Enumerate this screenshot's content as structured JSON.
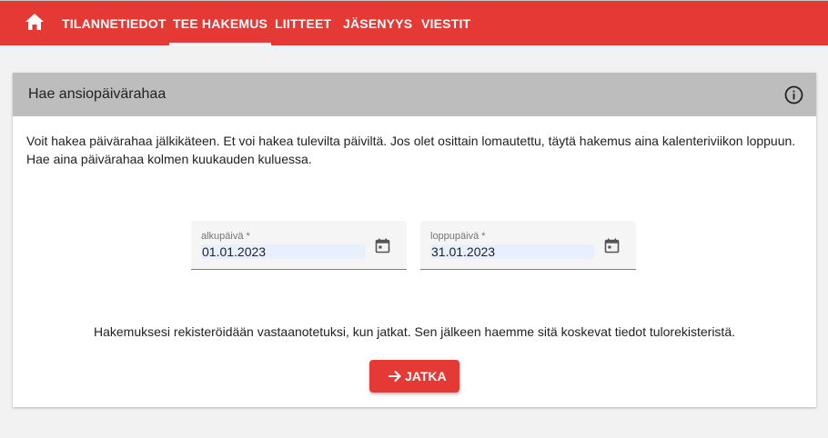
{
  "nav": {
    "home_icon": "home-icon",
    "items": [
      {
        "label": "TILANNETIEDOT",
        "active": false
      },
      {
        "label": "TEE HAKEMUS",
        "active": true
      },
      {
        "label": "LIITTEET",
        "active": false
      },
      {
        "label": "JÄSENYYS",
        "active": false
      },
      {
        "label": "VIESTIT",
        "active": false
      }
    ]
  },
  "card": {
    "title": "Hae ansiopäivärahaa",
    "info_icon": "info-icon",
    "intro_lines": [
      "Voit hakea päivärahaa jälkikäteen. Et voi hakea tulevilta päiviltä. Jos olet osittain lomautettu, täytä hakemus aina kalenteriviikon loppuun.",
      "Hae aina päivärahaa kolmen kuukauden kuluessa."
    ],
    "start_date": {
      "label": "alkupäivä *",
      "value": "01.01.2023",
      "icon": "calendar-icon"
    },
    "end_date": {
      "label": "loppupäivä *",
      "value": "31.01.2023",
      "icon": "calendar-icon"
    },
    "notice": "Hakemuksesi rekisteröidään vastaanotetuksi, kun jatkat. Sen jälkeen haemme sitä koskevat tiedot tulorekisteristä.",
    "continue_button": {
      "label": "JATKA",
      "icon": "arrow-right-icon"
    }
  },
  "colors": {
    "brand_red": "#e53935",
    "header_gray": "#bdbdbd",
    "autofill_blue": "#e8f0fe"
  }
}
